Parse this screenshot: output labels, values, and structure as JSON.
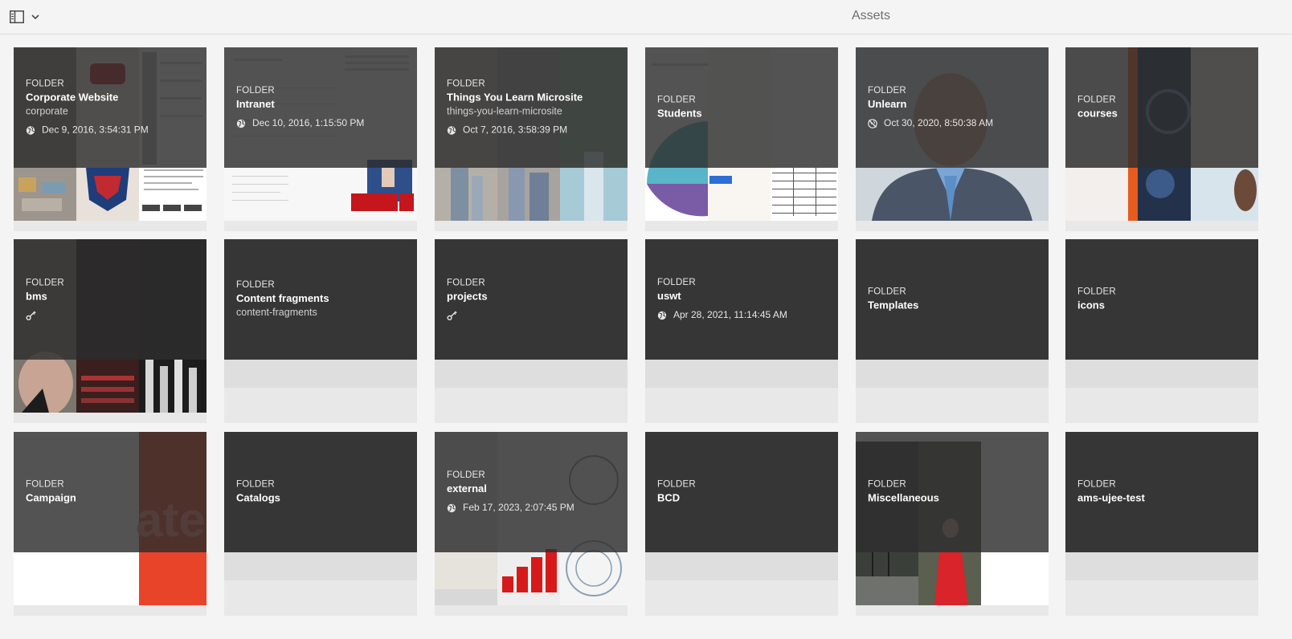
{
  "header": {
    "title": "Assets"
  },
  "icons": {
    "rail_toggle": "rail-toggle-icon",
    "dropdown": "chevron-down-icon",
    "published": "globe-icon",
    "unpublished": "globe-off-icon",
    "key": "key-icon"
  },
  "cards": [
    {
      "type": "FOLDER",
      "title": "Corporate Website",
      "subtitle": "corporate",
      "date": "Dec 9, 2016, 3:54:31 PM",
      "status": "published",
      "thumb": "corporate"
    },
    {
      "type": "FOLDER",
      "title": "Intranet",
      "subtitle": "",
      "date": "Dec 10, 2016, 1:15:50 PM",
      "status": "published",
      "thumb": "intranet"
    },
    {
      "type": "FOLDER",
      "title": "Things You Learn Microsite",
      "subtitle": "things-you-learn-microsite",
      "date": "Oct 7, 2016, 3:58:39 PM",
      "status": "published",
      "thumb": "things"
    },
    {
      "type": "FOLDER",
      "title": "Students",
      "subtitle": "",
      "date": "",
      "status": "",
      "thumb": "students"
    },
    {
      "type": "FOLDER",
      "title": "Unlearn",
      "subtitle": "",
      "date": "Oct 30, 2020, 8:50:38 AM",
      "status": "unpublished",
      "thumb": "unlearn"
    },
    {
      "type": "FOLDER",
      "title": "courses",
      "subtitle": "",
      "date": "",
      "status": "",
      "thumb": "courses"
    },
    {
      "type": "FOLDER",
      "title": "bms",
      "subtitle": "",
      "date": "",
      "status": "key",
      "thumb": "bms"
    },
    {
      "type": "FOLDER",
      "title": "Content fragments",
      "subtitle": "content-fragments",
      "date": "",
      "status": "",
      "thumb": ""
    },
    {
      "type": "FOLDER",
      "title": "projects",
      "subtitle": "",
      "date": "",
      "status": "key",
      "thumb": ""
    },
    {
      "type": "FOLDER",
      "title": "uswt",
      "subtitle": "",
      "date": "Apr 28, 2021, 11:14:45 AM",
      "status": "published",
      "thumb": ""
    },
    {
      "type": "FOLDER",
      "title": "Templates",
      "subtitle": "",
      "date": "",
      "status": "",
      "thumb": ""
    },
    {
      "type": "FOLDER",
      "title": "icons",
      "subtitle": "",
      "date": "",
      "status": "",
      "thumb": ""
    },
    {
      "type": "FOLDER",
      "title": "Campaign",
      "subtitle": "",
      "date": "",
      "status": "",
      "thumb": "campaign"
    },
    {
      "type": "FOLDER",
      "title": "Catalogs",
      "subtitle": "",
      "date": "",
      "status": "",
      "thumb": ""
    },
    {
      "type": "FOLDER",
      "title": "external",
      "subtitle": "",
      "date": "Feb 17, 2023, 2:07:45 PM",
      "status": "published",
      "thumb": "external"
    },
    {
      "type": "FOLDER",
      "title": "BCD",
      "subtitle": "",
      "date": "",
      "status": "",
      "thumb": ""
    },
    {
      "type": "FOLDER",
      "title": "Miscellaneous",
      "subtitle": "",
      "date": "",
      "status": "",
      "thumb": "misc"
    },
    {
      "type": "FOLDER",
      "title": "ams-ujee-test",
      "subtitle": "",
      "date": "",
      "status": "",
      "thumb": ""
    }
  ]
}
